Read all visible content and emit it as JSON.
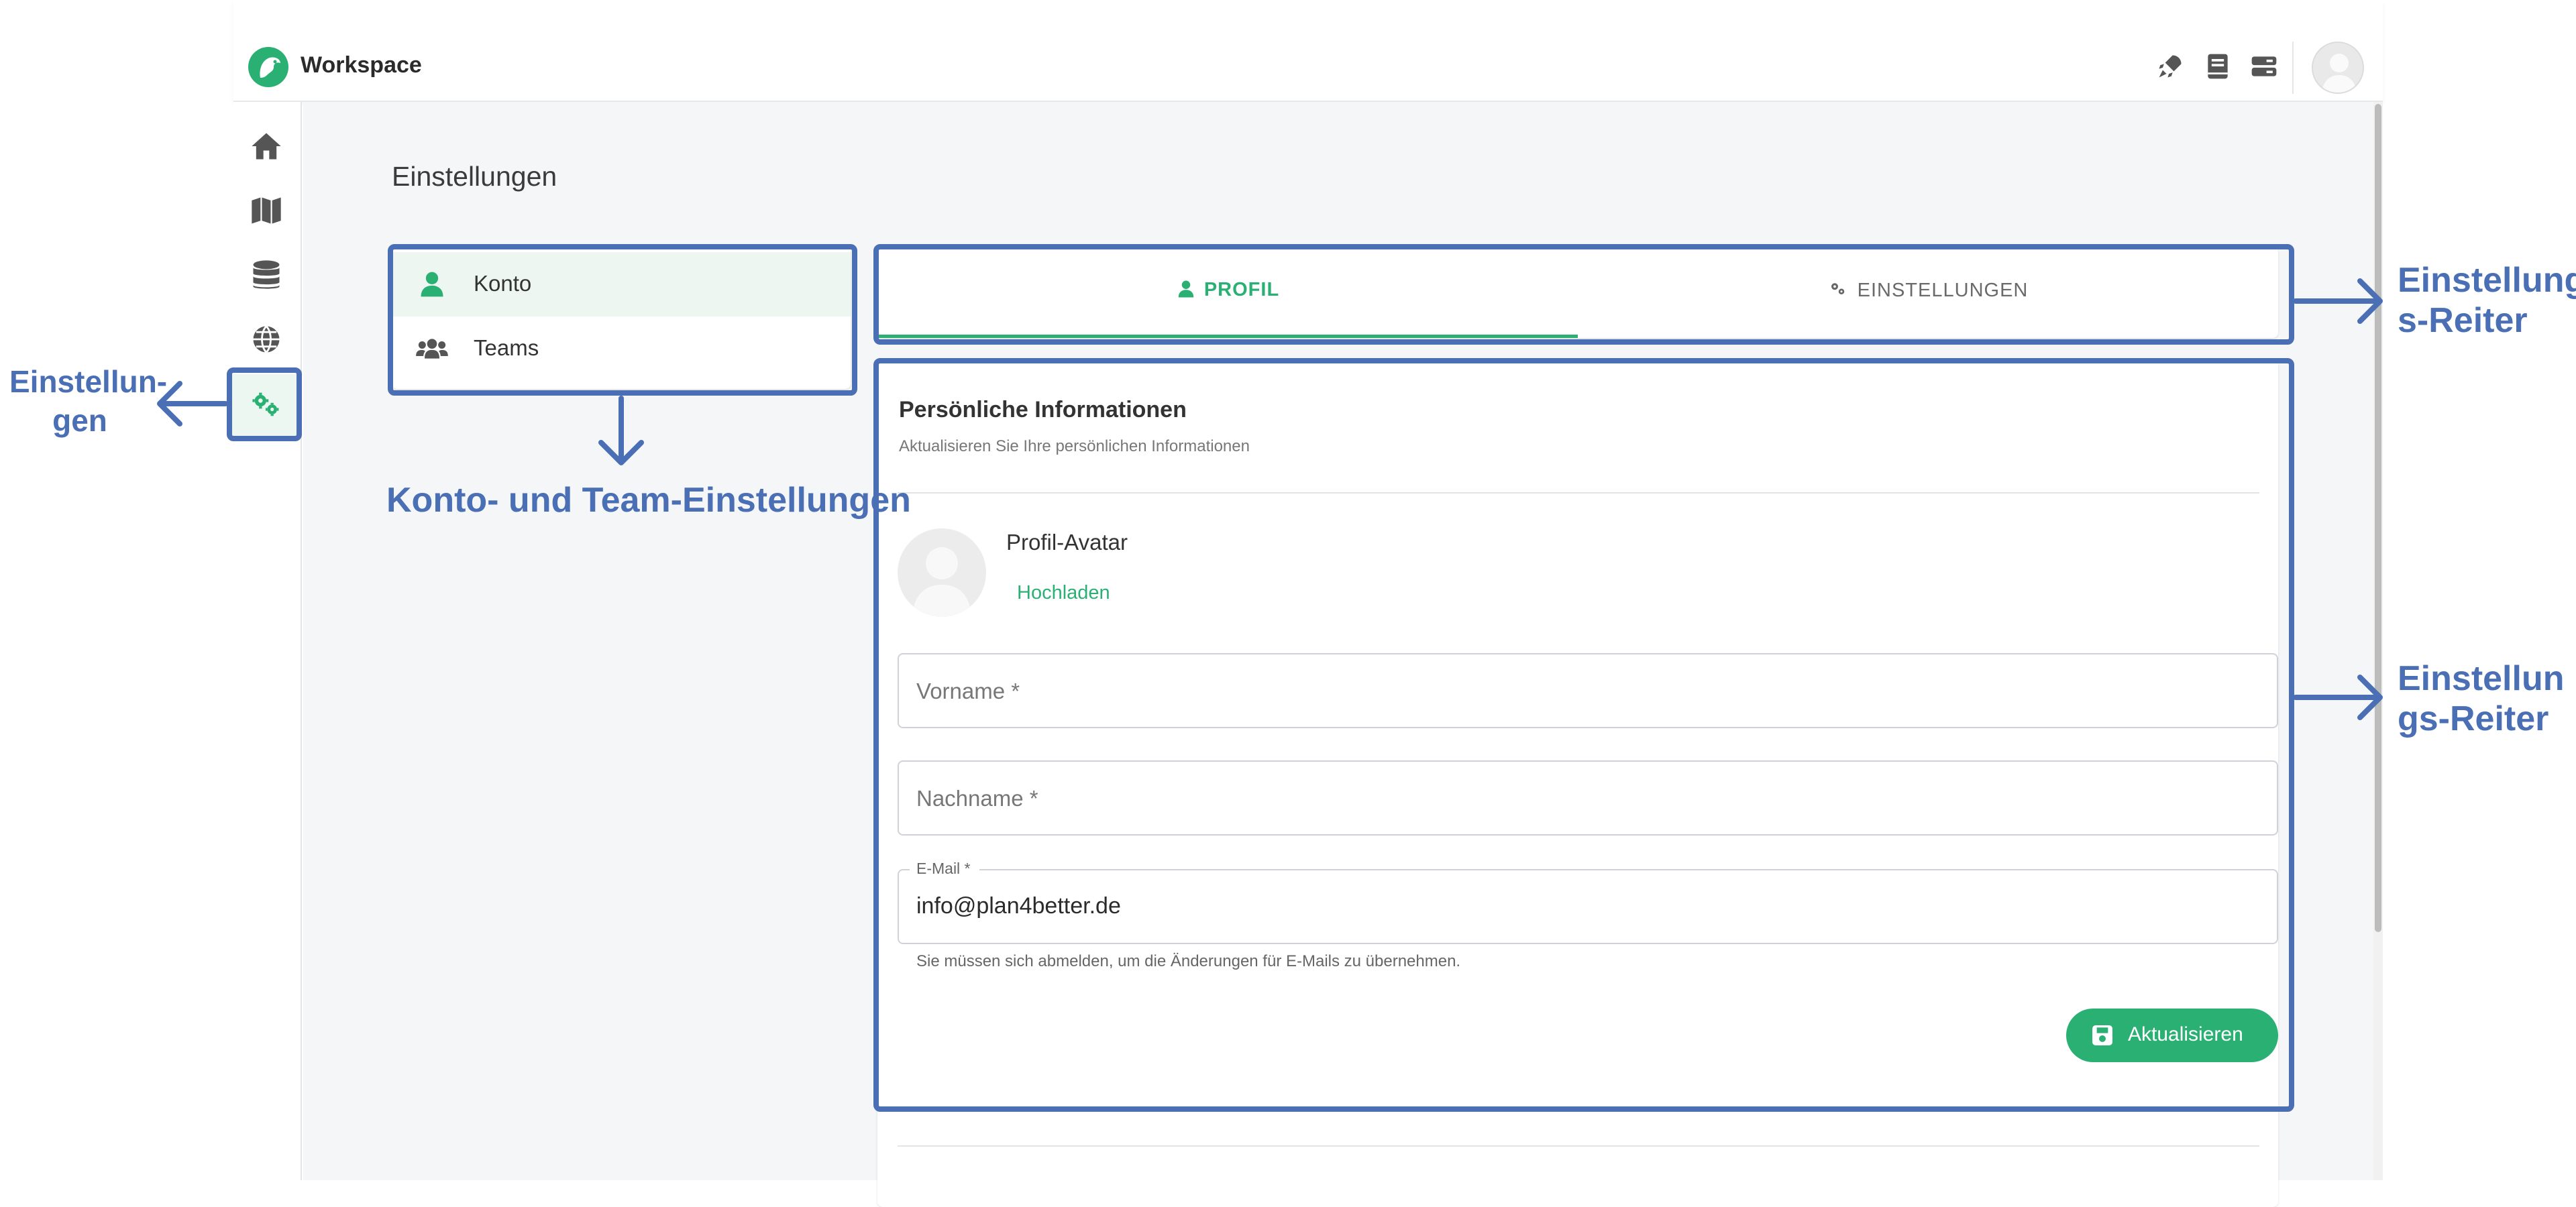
{
  "app": {
    "title": "Workspace",
    "brand_color": "#2bb074"
  },
  "topbar": {
    "icons": [
      "rocket-icon",
      "book-icon",
      "server-icon"
    ],
    "avatar": "user-avatar"
  },
  "sidebar": {
    "items": [
      {
        "name": "home-icon"
      },
      {
        "name": "map-icon"
      },
      {
        "name": "database-icon"
      },
      {
        "name": "globe-icon"
      },
      {
        "name": "gears-icon",
        "active": true
      }
    ]
  },
  "page": {
    "title": "Einstellungen"
  },
  "menu": {
    "items": [
      {
        "label": "Konto",
        "icon": "person-icon",
        "active": true
      },
      {
        "label": "Teams",
        "icon": "group-icon"
      }
    ]
  },
  "tabs": [
    {
      "label": "PROFIL",
      "icon": "person-icon",
      "active": true
    },
    {
      "label": "EINSTELLUNGEN",
      "icon": "gears-icon"
    }
  ],
  "profile": {
    "title": "Persönliche Informationen",
    "subtitle": "Aktualisieren Sie Ihre persönlichen Informationen",
    "avatar_label": "Profil-Avatar",
    "upload_label": "Hochladen",
    "firstname_placeholder": "Vorname *",
    "lastname_placeholder": "Nachname *",
    "email_label": "E-Mail *",
    "email_value": "info@plan4better.de",
    "email_help": "Sie müssen sich abmelden, um die Änderungen für E-Mails zu übernehmen.",
    "save_label": "Aktualisieren"
  },
  "annotations": {
    "settings_left": "Einstellun-\ngen",
    "konto_team": "Konto- und Team-Einstellungen",
    "tabs_right": "Einstellung\ns-Reiter",
    "content_right": "Einstellun\ngs-Reiter",
    "color": "#4a6fb5"
  }
}
